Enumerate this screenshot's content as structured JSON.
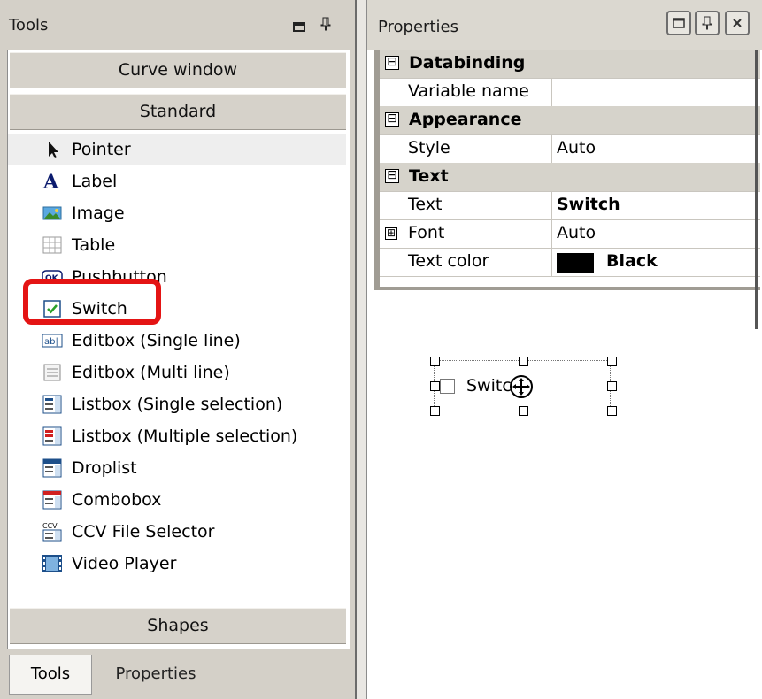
{
  "tools_panel": {
    "title": "Tools",
    "groups": {
      "curve_window": "Curve window",
      "standard": "Standard",
      "shapes": "Shapes"
    },
    "items": [
      {
        "label": "Pointer",
        "icon": "pointer-icon",
        "selected": true
      },
      {
        "label": "Label",
        "icon": "label-icon"
      },
      {
        "label": "Image",
        "icon": "image-icon"
      },
      {
        "label": "Table",
        "icon": "table-icon"
      },
      {
        "label": "Pushbutton",
        "icon": "pushbutton-icon"
      },
      {
        "label": "Switch",
        "icon": "switch-icon",
        "highlighted": true
      },
      {
        "label": "Editbox (Single line)",
        "icon": "editbox-single-icon"
      },
      {
        "label": "Editbox (Multi line)",
        "icon": "editbox-multi-icon"
      },
      {
        "label": "Listbox (Single selection)",
        "icon": "listbox-single-icon"
      },
      {
        "label": "Listbox (Multiple selection)",
        "icon": "listbox-multiple-icon"
      },
      {
        "label": "Droplist",
        "icon": "droplist-icon"
      },
      {
        "label": "Combobox",
        "icon": "combobox-icon"
      },
      {
        "label": "CCV File Selector",
        "icon": "ccv-file-selector-icon"
      },
      {
        "label": "Video Player",
        "icon": "video-player-icon"
      }
    ],
    "tabs": {
      "tools": "Tools",
      "properties": "Properties"
    },
    "highlight_color": "#e41414"
  },
  "properties_panel": {
    "title": "Properties",
    "categories": {
      "databinding": "Databinding",
      "appearance": "Appearance",
      "text": "Text"
    },
    "rows": {
      "variable_name": {
        "name": "Variable name",
        "value": ""
      },
      "style": {
        "name": "Style",
        "value": "Auto"
      },
      "text": {
        "name": "Text",
        "value": "Switch"
      },
      "font": {
        "name": "Font",
        "value": "Auto"
      },
      "text_color": {
        "name": "Text color",
        "value": "Black",
        "swatch": "#000000"
      }
    },
    "expander_collapse": "⊟",
    "expander_expand": "⊞"
  },
  "canvas": {
    "switch_label": "Switch"
  }
}
